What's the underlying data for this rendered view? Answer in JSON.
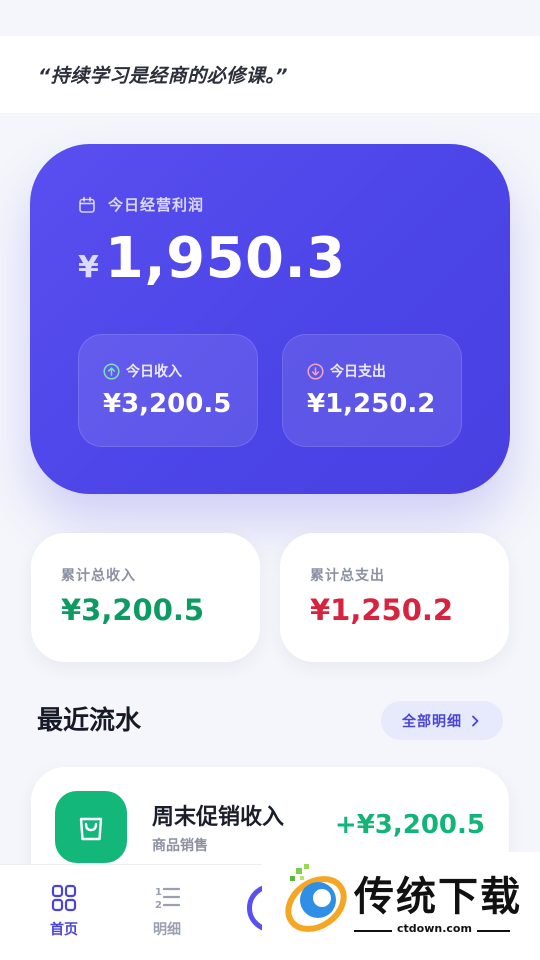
{
  "quote": "“持续学习是经商的必修课。”",
  "profit_card": {
    "label": "今日经营利润",
    "currency": "¥",
    "amount": "1,950.3",
    "income_label": "今日收入",
    "income_value": "¥3,200.5",
    "expense_label": "今日支出",
    "expense_value": "¥1,250.2"
  },
  "totals": {
    "income_label": "累计总收入",
    "income_value": "¥3,200.5",
    "expense_label": "累计总支出",
    "expense_value": "¥1,250.2"
  },
  "recent": {
    "title": "最近流水",
    "view_all": "全部明细"
  },
  "transactions": [
    {
      "title": "周末促销收入",
      "category": "商品销售",
      "amount": "+¥3,200.5",
      "icon": "shopping-bag-icon"
    }
  ],
  "tabs": [
    {
      "label": "首页",
      "icon": "grid-icon",
      "active": true
    },
    {
      "label": "明细",
      "icon": "list-icon",
      "active": false
    }
  ],
  "watermark": {
    "title": "传统下载",
    "url": "ctdown.com"
  },
  "colors": {
    "accent": "#4a44dc",
    "card": "#5046e5",
    "income": "#0e9a63",
    "expense": "#d8233f",
    "success_bg": "#13b77a"
  }
}
